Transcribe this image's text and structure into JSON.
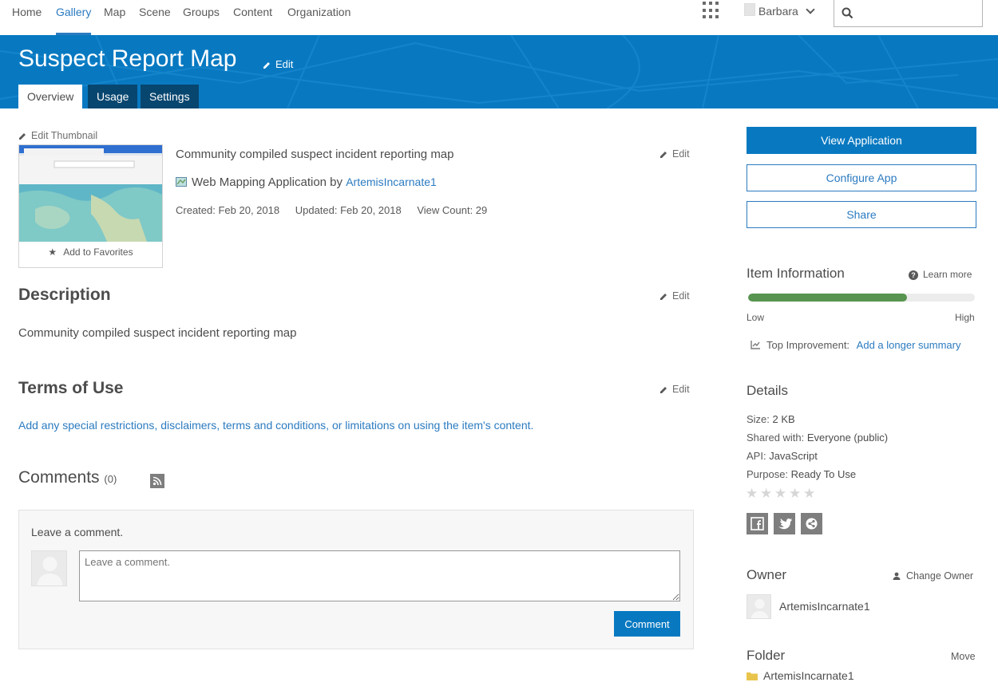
{
  "nav": {
    "items": [
      "Home",
      "Gallery",
      "Map",
      "Scene",
      "Groups",
      "Content",
      "Organization"
    ],
    "active": "Gallery",
    "user_name": "Barbara",
    "search_placeholder": ""
  },
  "banner": {
    "title": "Suspect Report Map",
    "edit_label": "Edit",
    "tabs": [
      "Overview",
      "Usage",
      "Settings"
    ],
    "active_tab": "Overview"
  },
  "summary": {
    "edit_thumbnail": "Edit Thumbnail",
    "text": "Community compiled suspect incident reporting map",
    "edit_label": "Edit",
    "item_type": "Web Mapping Application by",
    "owner_link": "ArtemisIncarnate1",
    "created": "Created: Feb 20, 2018",
    "updated": "Updated: Feb 20, 2018",
    "view_count": "View Count: 29",
    "add_favorites": "Add to Favorites"
  },
  "description": {
    "title": "Description",
    "edit_label": "Edit",
    "text": "Community compiled suspect incident reporting map"
  },
  "terms": {
    "title": "Terms of Use",
    "edit_label": "Edit",
    "placeholder_link": "Add any special restrictions, disclaimers, terms and conditions, or limitations on using the item's content."
  },
  "comments": {
    "title": "Comments",
    "count": "(0)",
    "leave_label": "Leave a comment.",
    "input_placeholder": "Leave a comment.",
    "button": "Comment"
  },
  "actions": {
    "view_app": "View Application",
    "configure_app": "Configure App",
    "share": "Share"
  },
  "item_info": {
    "title": "Item Information",
    "learn_more": "Learn more",
    "score_fraction": 0.7,
    "low": "Low",
    "high": "High",
    "top_improvement_label": "Top Improvement:",
    "top_improvement_link": "Add a longer summary"
  },
  "details": {
    "title": "Details",
    "size_label": "Size:",
    "size_value": "2 KB",
    "shared_label": "Shared with:",
    "shared_value": "Everyone (public)",
    "api_label": "API:",
    "api_value": "JavaScript",
    "purpose_label": "Purpose:",
    "purpose_value": "Ready To Use",
    "rating_stars": 0,
    "rating_max": 5
  },
  "owner": {
    "title": "Owner",
    "change_owner": "Change Owner",
    "name": "ArtemisIncarnate1"
  },
  "folder": {
    "title": "Folder",
    "move": "Move",
    "name": "ArtemisIncarnate1"
  },
  "colors": {
    "brand_blue": "#0879c1",
    "tab_dark": "#07466f",
    "score_green": "#57944f",
    "link": "#2b7bc0"
  }
}
